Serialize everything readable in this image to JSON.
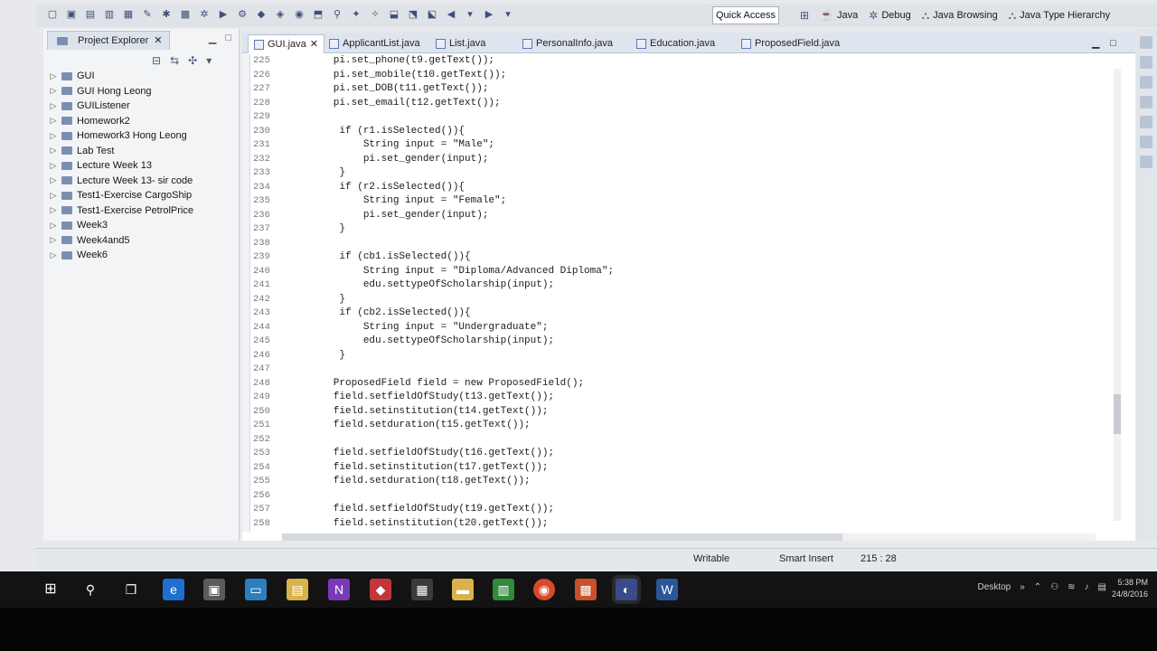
{
  "toolbar": {
    "quick_access": "Quick Access",
    "perspectives": [
      {
        "label": "Java",
        "icon": "java-perspective-icon"
      },
      {
        "label": "Debug",
        "icon": "debug-perspective-icon"
      },
      {
        "label": "Java Browsing",
        "icon": "java-browsing-icon"
      },
      {
        "label": "Java Type Hierarchy",
        "icon": "type-hierarchy-icon"
      }
    ]
  },
  "explorer": {
    "title": "Project Explorer",
    "items": [
      {
        "label": "GUI"
      },
      {
        "label": "GUI Hong Leong"
      },
      {
        "label": "GUIListener"
      },
      {
        "label": "Homework2"
      },
      {
        "label": "Homework3 Hong Leong"
      },
      {
        "label": "Lab Test"
      },
      {
        "label": "Lecture Week 13"
      },
      {
        "label": "Lecture Week 13- sir code"
      },
      {
        "label": "Test1-Exercise CargoShip"
      },
      {
        "label": "Test1-Exercise PetrolPrice"
      },
      {
        "label": "Week3"
      },
      {
        "label": "Week4and5"
      },
      {
        "label": "Week6"
      }
    ]
  },
  "editor": {
    "tabs": [
      {
        "label": "GUI.java",
        "active": true
      },
      {
        "label": "ApplicantList.java"
      },
      {
        "label": "List.java"
      },
      {
        "label": "PersonalInfo.java"
      },
      {
        "label": "Education.java"
      },
      {
        "label": "ProposedField.java"
      }
    ],
    "lines": [
      {
        "n": "225",
        "text": "        pi.set_phone(t9.getText());"
      },
      {
        "n": "226",
        "text": "        pi.set_mobile(t10.getText());"
      },
      {
        "n": "227",
        "text": "        pi.set_DOB(t11.getText());"
      },
      {
        "n": "228",
        "text": "        pi.set_email(t12.getText());"
      },
      {
        "n": "229",
        "text": ""
      },
      {
        "n": "230",
        "text": "         if (r1.isSelected()){"
      },
      {
        "n": "231",
        "text": "             String input = \"Male\";"
      },
      {
        "n": "232",
        "text": "             pi.set_gender(input);"
      },
      {
        "n": "233",
        "text": "         }"
      },
      {
        "n": "234",
        "text": "         if (r2.isSelected()){"
      },
      {
        "n": "235",
        "text": "             String input = \"Female\";"
      },
      {
        "n": "236",
        "text": "             pi.set_gender(input);"
      },
      {
        "n": "237",
        "text": "         }"
      },
      {
        "n": "238",
        "text": ""
      },
      {
        "n": "239",
        "text": "         if (cb1.isSelected()){"
      },
      {
        "n": "240",
        "text": "             String input = \"Diploma/Advanced Diploma\";"
      },
      {
        "n": "241",
        "text": "             edu.settypeOfScholarship(input);"
      },
      {
        "n": "242",
        "text": "         }"
      },
      {
        "n": "243",
        "text": "         if (cb2.isSelected()){"
      },
      {
        "n": "244",
        "text": "             String input = \"Undergraduate\";"
      },
      {
        "n": "245",
        "text": "             edu.settypeOfScholarship(input);"
      },
      {
        "n": "246",
        "text": "         }"
      },
      {
        "n": "247",
        "text": ""
      },
      {
        "n": "248",
        "text": "        ProposedField field = new ProposedField();"
      },
      {
        "n": "249",
        "text": "        field.setfieldOfStudy(t13.getText());"
      },
      {
        "n": "250",
        "text": "        field.setinstitution(t14.getText());"
      },
      {
        "n": "251",
        "text": "        field.setduration(t15.getText());"
      },
      {
        "n": "252",
        "text": ""
      },
      {
        "n": "253",
        "text": "        field.setfieldOfStudy(t16.getText());"
      },
      {
        "n": "254",
        "text": "        field.setinstitution(t17.getText());"
      },
      {
        "n": "255",
        "text": "        field.setduration(t18.getText());"
      },
      {
        "n": "256",
        "text": ""
      },
      {
        "n": "257",
        "text": "        field.setfieldOfStudy(t19.getText());"
      },
      {
        "n": "258",
        "text": "        field.setinstitution(t20.getText());"
      }
    ]
  },
  "status": {
    "writable": "Writable",
    "insert_mode": "Smart Insert",
    "position": "215 : 28"
  },
  "taskbar": {
    "desktop": "Desktop",
    "time": "5:38 PM",
    "date": "24/8/2016"
  },
  "colors": {
    "string_literal": "#2a00ff",
    "editor_bg": "#ffffff",
    "taskbar_bg": "#131313"
  }
}
